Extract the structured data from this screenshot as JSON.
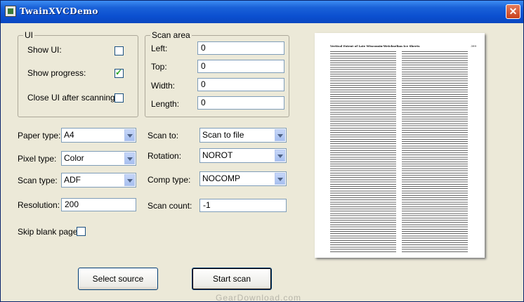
{
  "window": {
    "title": "TwainXVCDemo",
    "close_glyph": "✕"
  },
  "ui_group": {
    "label": "UI",
    "show_ui_label": "Show UI:",
    "show_ui_checked": false,
    "show_progress_label": "Show progress:",
    "show_progress_checked": true,
    "close_ui_label": "Close UI after scanning:",
    "close_ui_checked": false
  },
  "scan_area": {
    "label": "Scan area",
    "left_label": "Left:",
    "left_value": "0",
    "top_label": "Top:",
    "top_value": "0",
    "width_label": "Width:",
    "width_value": "0",
    "length_label": "Length:",
    "length_value": "0"
  },
  "settings": {
    "paper_type_label": "Paper type:",
    "paper_type_value": "A4",
    "pixel_type_label": "Pixel type:",
    "pixel_type_value": "Color",
    "scan_type_label": "Scan type:",
    "scan_type_value": "ADF",
    "resolution_label": "Resolution:",
    "resolution_value": "200",
    "skip_blank_label": "Skip blank page:",
    "skip_blank_checked": false,
    "scan_to_label": "Scan to:",
    "scan_to_value": "Scan to file",
    "rotation_label": "Rotation:",
    "rotation_value": "NOROT",
    "comp_type_label": "Comp type:",
    "comp_type_value": "NOCOMP",
    "scan_count_label": "Scan count:",
    "scan_count_value": "-1"
  },
  "buttons": {
    "select_source": "Select source",
    "start_scan": "Start scan"
  },
  "preview": {
    "header": "Vertical Extent of Late Wisconsin-Weichselian Ice Sheets",
    "page_number": "399"
  },
  "watermark": "GearDownload.com",
  "colors": {
    "titlebar": "#0b4fd0",
    "window_bg": "#ece9d8",
    "checkmark": "#21a121"
  }
}
